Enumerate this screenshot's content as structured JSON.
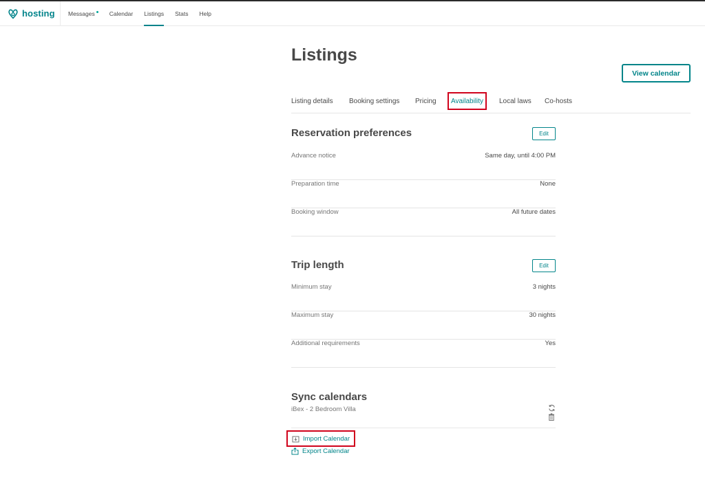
{
  "header": {
    "brand": "hosting",
    "nav": [
      {
        "label": "Messages",
        "notification": true
      },
      {
        "label": "Calendar"
      },
      {
        "label": "Listings",
        "active": true
      },
      {
        "label": "Stats"
      },
      {
        "label": "Help"
      }
    ]
  },
  "page": {
    "title": "Listings",
    "view_calendar_label": "View calendar"
  },
  "tabs": [
    {
      "label": "Listing details"
    },
    {
      "label": "Booking settings"
    },
    {
      "label": "Pricing"
    },
    {
      "label": "Availability",
      "active": true
    },
    {
      "label": "Local laws"
    },
    {
      "label": "Co-hosts"
    }
  ],
  "reservation": {
    "title": "Reservation preferences",
    "edit_label": "Edit",
    "rows": [
      {
        "label": "Advance notice",
        "value": "Same day, until 4:00 PM"
      },
      {
        "label": "Preparation time",
        "value": "None"
      },
      {
        "label": "Booking window",
        "value": "All future dates"
      }
    ]
  },
  "trip": {
    "title": "Trip length",
    "edit_label": "Edit",
    "rows": [
      {
        "label": "Minimum stay",
        "value": "3 nights"
      },
      {
        "label": "Maximum stay",
        "value": "30 nights"
      },
      {
        "label": "Additional requirements",
        "value": "Yes"
      }
    ]
  },
  "sync": {
    "title": "Sync calendars",
    "calendar_name": "iBex - 2 Bedroom Villa",
    "import_label": "Import Calendar",
    "export_label": "Export Calendar"
  },
  "colors": {
    "brand": "#008489",
    "highlight": "#d0021b",
    "text": "#484848",
    "muted": "#767676"
  },
  "icons": [
    "airbnb-logo-icon",
    "refresh-icon",
    "trash-icon",
    "import-icon",
    "export-icon"
  ]
}
